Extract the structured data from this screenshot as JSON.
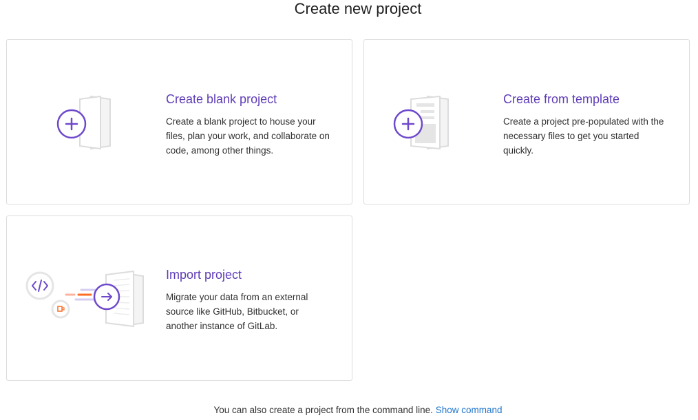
{
  "page": {
    "title": "Create new project"
  },
  "cards": {
    "blank": {
      "title": "Create blank project",
      "description": "Create a blank project to house your files, plan your work, and collaborate on code, among other things.",
      "icon": "blank-project-illustration"
    },
    "template": {
      "title": "Create from template",
      "description": "Create a project pre-populated with the necessary files to get you started quickly.",
      "icon": "template-project-illustration"
    },
    "import": {
      "title": "Import project",
      "description": "Migrate your data from an external source like GitHub, Bitbucket, or another instance of GitLab.",
      "icon": "import-project-illustration"
    }
  },
  "footer": {
    "text": "You can also create a project from the command line.",
    "link": "Show command"
  },
  "colors": {
    "accent": "#5f3db7",
    "link": "#1f75cb",
    "border": "#dcdcde",
    "orange": "#e24329"
  }
}
